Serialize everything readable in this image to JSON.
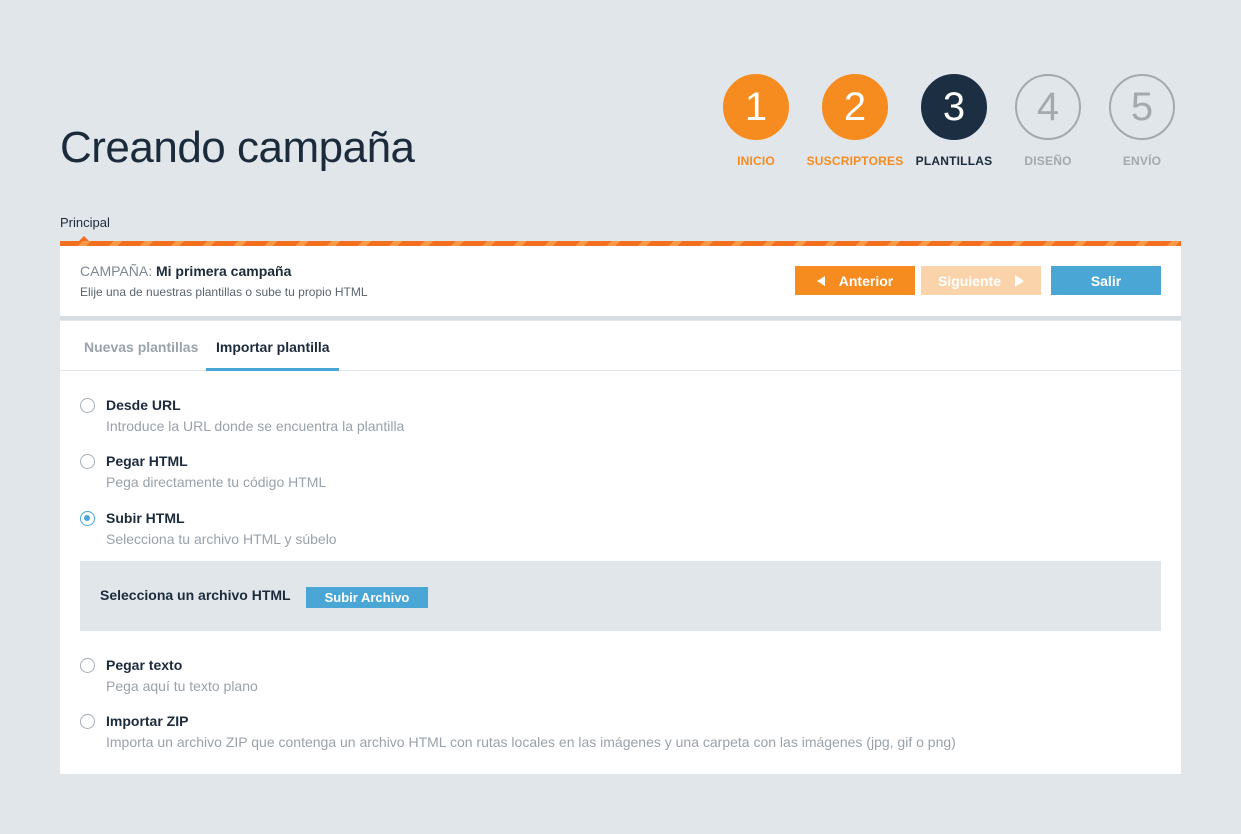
{
  "page": {
    "title": "Creando campaña"
  },
  "steps": [
    {
      "number": "1",
      "label": "INICIO",
      "state": "done"
    },
    {
      "number": "2",
      "label": "SUSCRIPTORES",
      "state": "done"
    },
    {
      "number": "3",
      "label": "PLANTILLAS",
      "state": "current"
    },
    {
      "number": "4",
      "label": "DISEÑO",
      "state": "pending"
    },
    {
      "number": "5",
      "label": "ENVÍO",
      "state": "pending"
    }
  ],
  "section": {
    "tab_label": "Principal"
  },
  "header": {
    "campaign_prefix": "CAMPAÑA:",
    "campaign_name": "Mi primera campaña",
    "subtitle": "Elije una de nuestras plantillas o sube tu propio HTML",
    "prev_label": "Anterior",
    "next_label": "Siguiente",
    "exit_label": "Salir"
  },
  "tabs": [
    {
      "label": "Nuevas plantillas",
      "active": false
    },
    {
      "label": "Importar plantilla",
      "active": true
    }
  ],
  "options": [
    {
      "title": "Desde URL",
      "description": "Introduce la URL donde se encuentra la plantilla",
      "selected": false
    },
    {
      "title": "Pegar HTML",
      "description": "Pega directamente tu código HTML",
      "selected": false
    },
    {
      "title": "Subir HTML",
      "description": "Selecciona tu archivo HTML y súbelo",
      "selected": true
    },
    {
      "title": "Pegar texto",
      "description": "Pega aquí tu texto plano",
      "selected": false
    },
    {
      "title": "Importar ZIP",
      "description": "Importa un archivo ZIP que contenga un archivo HTML con rutas locales en las imágenes y una carpeta con las imágenes (jpg, gif o png)",
      "selected": false
    }
  ],
  "upload": {
    "label": "Selecciona un archivo HTML",
    "button_label": "Subir Archivo"
  },
  "colors": {
    "accent_orange": "#f68b1f",
    "accent_blue": "#4aa7d5",
    "navy": "#1c2e42",
    "background": "#e1e6ea"
  }
}
